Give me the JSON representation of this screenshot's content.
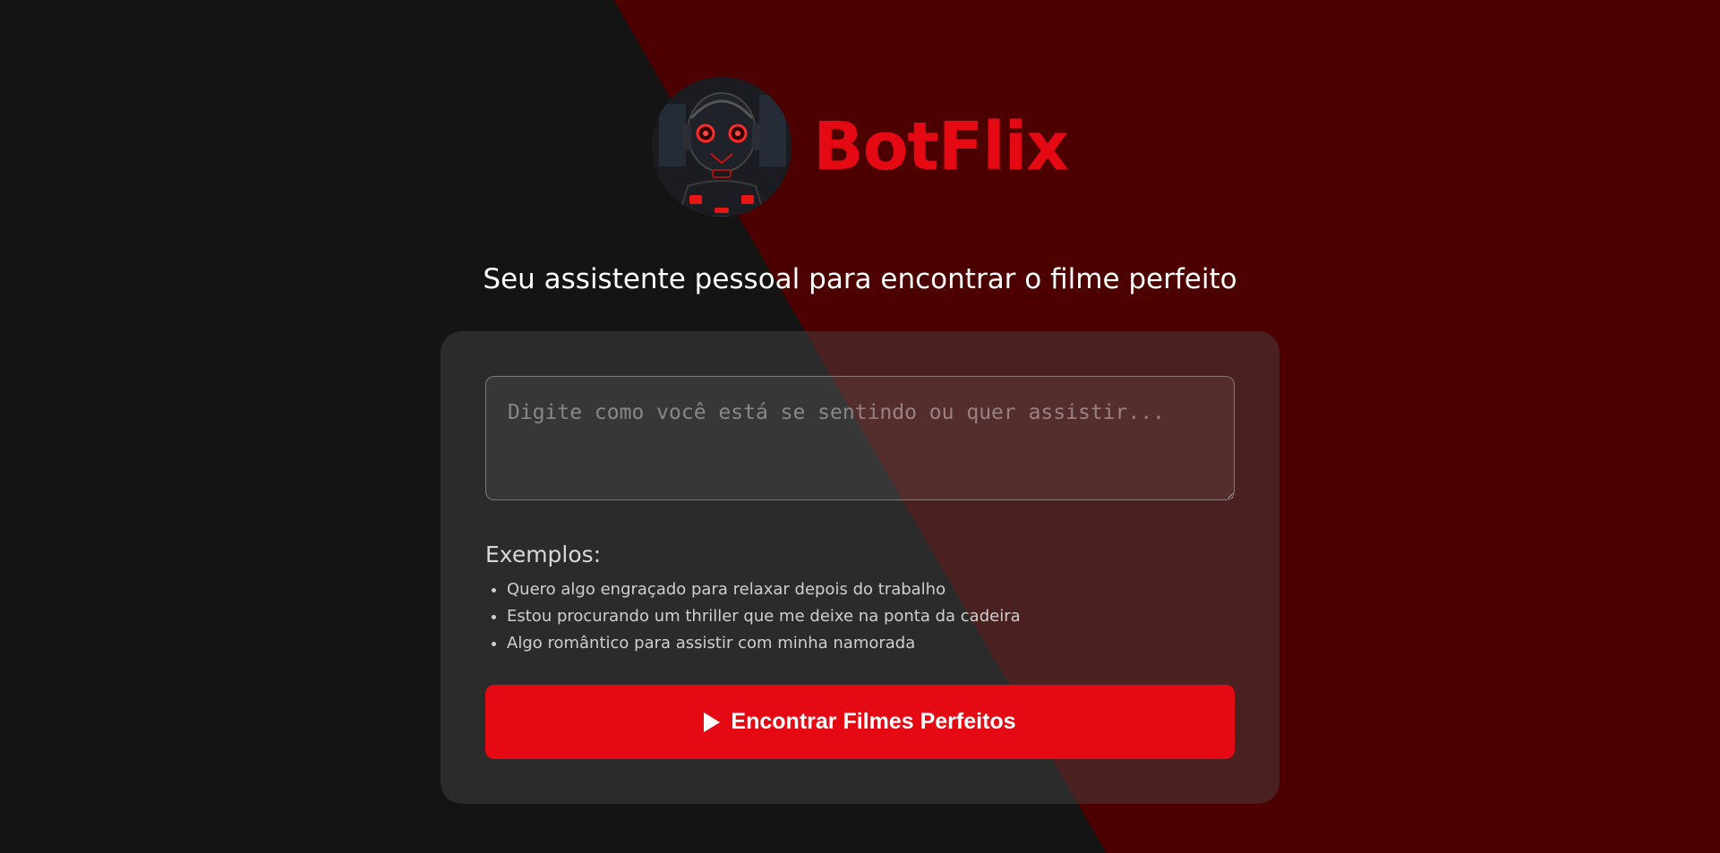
{
  "app": {
    "brand": "BotFlix",
    "tagline": "Seu assistente pessoal para encontrar o filme perfeito",
    "logo_icon": "robot-avatar-icon"
  },
  "form": {
    "input_placeholder": "Digite como você está se sentindo ou quer assistir...",
    "input_value": "",
    "examples_title": "Exemplos:",
    "examples": [
      "Quero algo engraçado para relaxar depois do trabalho",
      "Estou procurando um thriller que me deixe na ponta da cadeira",
      "Algo romântico para assistir com minha namorada"
    ],
    "submit_label": "Encontrar Filmes Perfeitos",
    "submit_icon": "play-icon"
  },
  "colors": {
    "accent": "#e50914",
    "bg_dark": "#141414",
    "bg_red": "#4d0000"
  }
}
